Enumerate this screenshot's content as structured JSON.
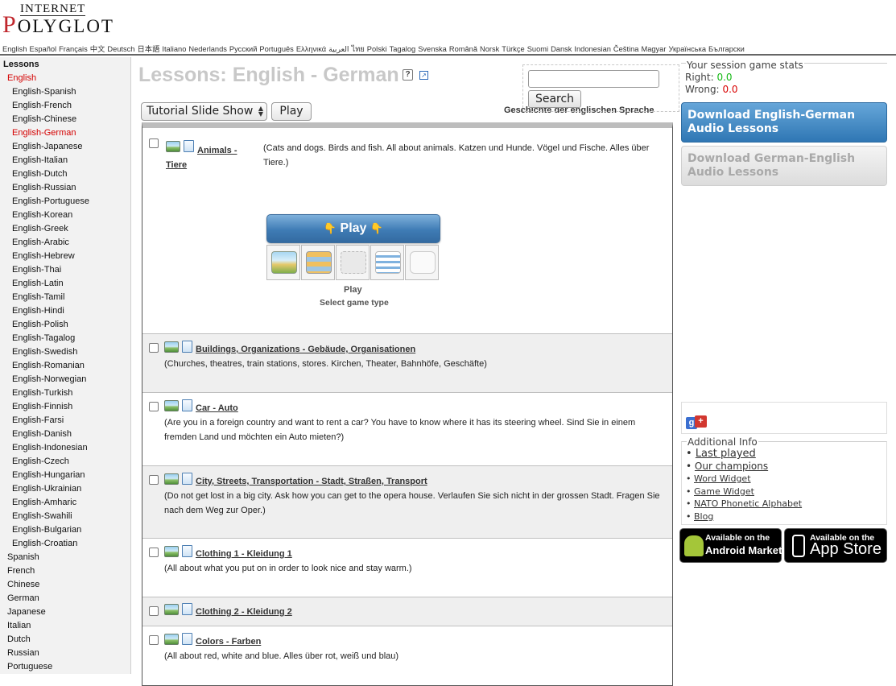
{
  "logo": {
    "top": "INTERNET",
    "main_first": "P",
    "main_rest": "OLYGLOT"
  },
  "languages": [
    "English",
    "Español",
    "Français",
    "中文",
    "Deutsch",
    "日本語",
    "Italiano",
    "Nederlands",
    "Русский",
    "Português",
    "Ελληνικά",
    "العربية",
    "ไทย",
    "Polski",
    "Tagalog",
    "Svenska",
    "Română",
    "Norsk",
    "Türkçe",
    "Suomi",
    "Dansk",
    "Indonesian",
    "Čeština",
    "Magyar",
    "Українська",
    "Български"
  ],
  "sidebar": {
    "title": "Lessons",
    "items": [
      "English",
      "English-Spanish",
      "English-French",
      "English-Chinese",
      "English-German",
      "English-Japanese",
      "English-Italian",
      "English-Dutch",
      "English-Russian",
      "English-Portuguese",
      "English-Korean",
      "English-Greek",
      "English-Arabic",
      "English-Hebrew",
      "English-Thai",
      "English-Latin",
      "English-Tamil",
      "English-Hindi",
      "English-Polish",
      "English-Tagalog",
      "English-Swedish",
      "English-Romanian",
      "English-Norwegian",
      "English-Turkish",
      "English-Finnish",
      "English-Farsi",
      "English-Danish",
      "English-Indonesian",
      "English-Czech",
      "English-Hungarian",
      "English-Ukrainian",
      "English-Amharic",
      "English-Swahili",
      "English-Bulgarian",
      "English-Croatian",
      "Spanish",
      "French",
      "Chinese",
      "German",
      "Japanese",
      "Italian",
      "Dutch",
      "Russian",
      "Portuguese"
    ]
  },
  "main": {
    "title": "Lessons: English - German",
    "help_glyph": "?",
    "ext_glyph": "↗",
    "search": {
      "value": "",
      "placeholder": "",
      "button": "Search"
    },
    "overlap_text": "Geschichte der englischen Sprache",
    "mode_select": "Tutorial Slide Show",
    "play_button": "Play",
    "lessons": [
      {
        "title": "Animals - Tiere",
        "title_line1": "Animals -",
        "title_line2": "Tiere",
        "desc": "(Cats and dogs. Birds and fish. All about animals. Katzen und Hunde. Vögel und Fische. Alles über Tiere.)"
      },
      {
        "title": "Buildings, Organizations - Gebäude, Organisationen",
        "desc": "(Churches, theatres, train stations, stores. Kirchen, Theater, Bahnhöfe, Geschäfte)"
      },
      {
        "title": "Car - Auto",
        "desc": "(Are you in a foreign country and want to rent a car? You have to know where it has its steering wheel. Sind Sie in einem fremden Land und möchten ein Auto mieten?)"
      },
      {
        "title": "City, Streets, Transportation - Stadt, Straßen, Transport",
        "desc": "(Do not get lost in a big city. Ask how you can get to the opera house. Verlaufen Sie sich nicht in der grossen Stadt. Fragen Sie nach dem Weg zur Oper.)"
      },
      {
        "title": "Clothing 1 - Kleidung 1",
        "desc": "(All about what you put on in order to look nice and stay warm.)"
      },
      {
        "title": "Clothing 2 - Kleidung 2",
        "desc": ""
      },
      {
        "title": "Colors - Farben",
        "desc": "(All about red, white and blue. Alles über rot, weiß und blau)"
      }
    ],
    "game": {
      "play_label": "Play",
      "play_sub": "Play",
      "select_label": "Select game type",
      "hand": "👇"
    }
  },
  "stats": {
    "title": "Your session game stats",
    "right_label": "Right:",
    "right_value": "0.0",
    "wrong_label": "Wrong:",
    "wrong_value": "0.0"
  },
  "downloads": {
    "en_de": "Download English-German Audio Lessons",
    "de_en": "Download German-English Audio Lessons"
  },
  "gplus": {
    "g": "g",
    "plus": "+"
  },
  "info": {
    "title": "Additional Info",
    "links": [
      "Last played",
      "Our champions",
      "Word Widget",
      "Game Widget",
      "NATO Phonetic Alphabet",
      "Blog"
    ]
  },
  "badges": {
    "android_small": "Available on the",
    "android_big": "Android Market",
    "appstore_small": "Available on the",
    "appstore_big": "App Store"
  },
  "colors": {
    "accent_blue": "#3f7cb5",
    "active_red": "#d40000",
    "right_green": "#14b814"
  }
}
